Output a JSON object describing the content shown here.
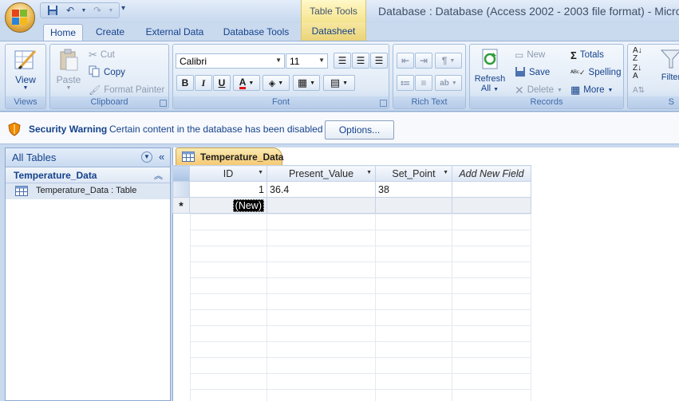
{
  "window": {
    "title": "Database : Database (Access 2002 - 2003 file format) - Microsof",
    "context_tab_group": "Table Tools"
  },
  "tabs": [
    {
      "label": "Home",
      "active": true
    },
    {
      "label": "Create"
    },
    {
      "label": "External Data"
    },
    {
      "label": "Database Tools"
    },
    {
      "label": "Datasheet",
      "contextual": true
    }
  ],
  "ribbon": {
    "views": {
      "group_label": "Views",
      "view_button": "View"
    },
    "clipboard": {
      "group_label": "Clipboard",
      "paste": "Paste",
      "cut": "Cut",
      "copy": "Copy",
      "format_painter": "Format Painter"
    },
    "font": {
      "group_label": "Font",
      "font_name": "Calibri",
      "font_size": "11",
      "bold": "B",
      "italic": "I",
      "underline": "U"
    },
    "rich_text": {
      "group_label": "Rich Text"
    },
    "records": {
      "group_label": "Records",
      "refresh": "Refresh",
      "refresh_sub": "All",
      "new": "New",
      "save": "Save",
      "delete": "Delete",
      "totals": "Totals",
      "spelling": "Spelling",
      "more": "More"
    },
    "sort_filter": {
      "filter": "Filter",
      "group_label_partial": "S"
    }
  },
  "security_bar": {
    "title": "Security Warning",
    "message": "Certain content in the database has been disabled",
    "options_button": "Options..."
  },
  "nav_pane": {
    "header": "All Tables",
    "group": "Temperature_Data",
    "item": "Temperature_Data : Table"
  },
  "document": {
    "tab_label": "Temperature_Data",
    "columns": [
      "ID",
      "Present_Value",
      "Set_Point",
      "Add New Field"
    ],
    "rows": [
      {
        "ID": "1",
        "Present_Value": "36.4",
        "Set_Point": "38"
      }
    ],
    "new_row_marker": "*",
    "new_row_placeholder": "(New)"
  },
  "colors": {
    "accent_text": "#15428b",
    "contextual_tab": "#f5e48e",
    "warning_shield": "#f08a00"
  }
}
